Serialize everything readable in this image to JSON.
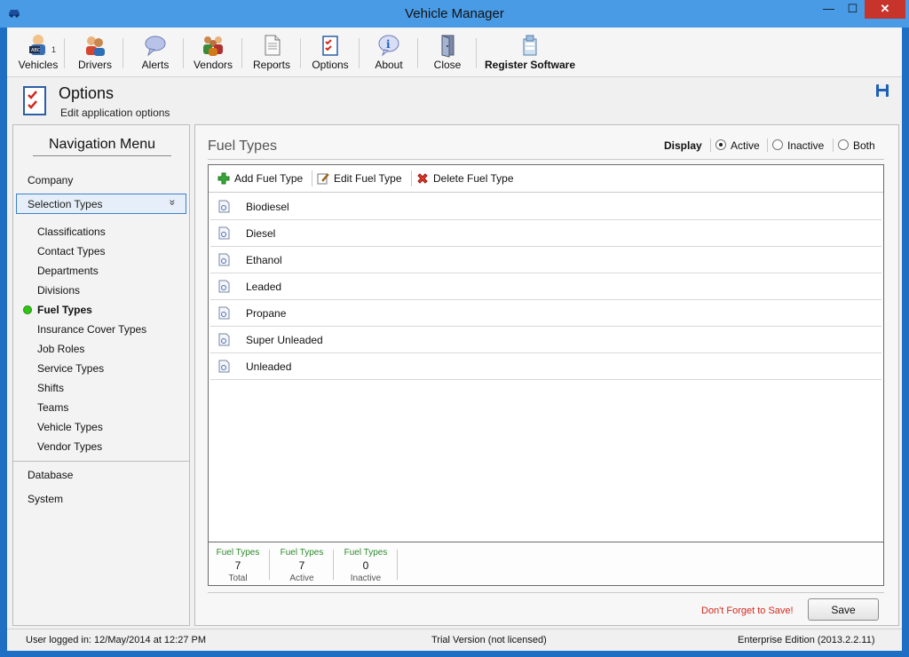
{
  "window": {
    "title": "Vehicle Manager",
    "minimize": "—",
    "maximize": "☐",
    "close": "✕"
  },
  "toolbar": {
    "items": [
      {
        "label": "Vehicles",
        "icon": "vehicles-icon"
      },
      {
        "label": "Drivers",
        "icon": "drivers-icon"
      },
      {
        "label": "Alerts",
        "icon": "alerts-icon"
      },
      {
        "label": "Vendors",
        "icon": "vendors-icon"
      },
      {
        "label": "Reports",
        "icon": "reports-icon"
      },
      {
        "label": "Options",
        "icon": "options-icon"
      },
      {
        "label": "About",
        "icon": "about-icon"
      },
      {
        "label": "Close",
        "icon": "close-door-icon"
      },
      {
        "label": "Register Software",
        "icon": "register-icon"
      }
    ],
    "vehicles_badge": "1"
  },
  "header": {
    "title": "Options",
    "subtitle": "Edit application options"
  },
  "nav": {
    "title": "Navigation Menu",
    "company": "Company",
    "selected_group": "Selection Types",
    "chevron": "»",
    "sub_items": [
      "Classifications",
      "Contact Types",
      "Departments",
      "Divisions",
      "Fuel Types",
      "Insurance Cover Types",
      "Job Roles",
      "Service Types",
      "Shifts",
      "Teams",
      "Vehicle Types",
      "Vendor Types"
    ],
    "active_sub_item": "Fuel Types",
    "database": "Database",
    "system": "System"
  },
  "content": {
    "title": "Fuel Types",
    "display_label": "Display",
    "display_options": [
      "Active",
      "Inactive",
      "Both"
    ],
    "display_selected": "Active",
    "actions": {
      "add": "Add Fuel Type",
      "edit": "Edit Fuel Type",
      "delete": "Delete Fuel Type"
    },
    "rows": [
      "Biodiesel",
      "Diesel",
      "Ethanol",
      "Leaded",
      "Propane",
      "Super Unleaded",
      "Unleaded"
    ],
    "stats": [
      {
        "caption": "Fuel Types",
        "value": "7",
        "label": "Total"
      },
      {
        "caption": "Fuel Types",
        "value": "7",
        "label": "Active"
      },
      {
        "caption": "Fuel Types",
        "value": "0",
        "label": "Inactive"
      }
    ],
    "reminder": "Don't Forget to Save!",
    "save_label": "Save"
  },
  "status": {
    "user": "User logged in:  12/May/2014 at 12:27 PM",
    "license": "Trial Version (not licensed)",
    "edition": "Enterprise Edition (2013.2.2.11)"
  },
  "colors": {
    "titlebar": "#4a9be6",
    "close": "#c7342b",
    "accent": "#3c7fd1",
    "active_dot": "#32c414",
    "reminder": "#d42a1e",
    "stat_caption": "#2d8a2d"
  }
}
